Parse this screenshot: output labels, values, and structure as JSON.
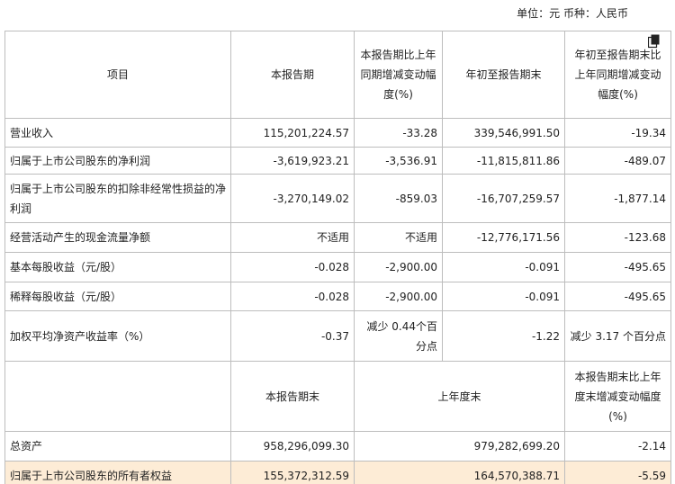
{
  "unit_line": "单位：元  币种：人民币",
  "header1": {
    "item": "项目",
    "current": "本报告期",
    "current_change": "本报告期比上年同期增减变动幅度(%)",
    "ytd": "年初至报告期末",
    "ytd_change": "年初至报告期末比上年同期增减变动幅度(%)"
  },
  "rows1": [
    {
      "item": "营业收入",
      "current": "115,201,224.57",
      "current_change": "-33.28",
      "ytd": "339,546,991.50",
      "ytd_change": "-19.34"
    },
    {
      "item": "归属于上市公司股东的净利润",
      "current": "-3,619,923.21",
      "current_change": "-3,536.91",
      "ytd": "-11,815,811.86",
      "ytd_change": "-489.07"
    },
    {
      "item": "归属于上市公司股东的扣除非经常性损益的净利润",
      "current": "-3,270,149.02",
      "current_change": "-859.03",
      "ytd": "-16,707,259.57",
      "ytd_change": "-1,877.14"
    },
    {
      "item": "经营活动产生的现金流量净额",
      "current": "不适用",
      "current_change": "不适用",
      "ytd": "-12,776,171.56",
      "ytd_change": "-123.68"
    },
    {
      "item": "基本每股收益（元/股）",
      "current": "-0.028",
      "current_change": "-2,900.00",
      "ytd": "-0.091",
      "ytd_change": "-495.65"
    },
    {
      "item": "稀释每股收益（元/股）",
      "current": "-0.028",
      "current_change": "-2,900.00",
      "ytd": "-0.091",
      "ytd_change": "-495.65"
    },
    {
      "item": "加权平均净资产收益率（%）",
      "current": "-0.37",
      "current_change": "减少 0.44个百分点",
      "ytd": "-1.22",
      "ytd_change": "减少 3.17 个百分点"
    }
  ],
  "header2": {
    "period_end": "本报告期末",
    "prior_year_end": "上年度末",
    "change": "本报告期末比上年度末增减变动幅度(%)"
  },
  "rows2": [
    {
      "item": "总资产",
      "period_end": "958,296,099.30",
      "prior_year_end": "979,282,699.20",
      "change": "-2.14"
    },
    {
      "item": "归属于上市公司股东的所有者权益",
      "period_end": "155,372,312.59",
      "prior_year_end": "164,570,388.71",
      "change": "-5.59"
    }
  ]
}
